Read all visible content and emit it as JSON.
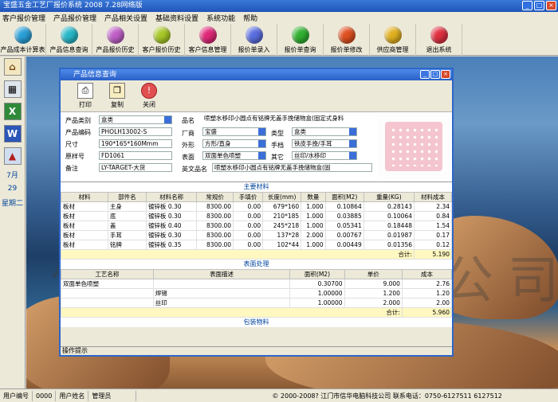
{
  "app": {
    "title": "宝盛五金工艺厂报价系统 2008 7.28网络版"
  },
  "menu": [
    "客户报价管理",
    "产品报价管理",
    "产品相关设置",
    "基础资料设置",
    "系统功能",
    "帮助"
  ],
  "toolbar": [
    {
      "label": "产品成本计算表",
      "color": "#2aa0d8"
    },
    {
      "label": "产品信息查询",
      "color": "#28b8c8"
    },
    {
      "label": "产品报价历史",
      "color": "#c060c8"
    },
    {
      "label": "客户报价历史",
      "color": "#a8c828"
    },
    {
      "label": "客户信息管理",
      "color": "#e02878"
    },
    {
      "label": "报价单录入",
      "color": "#5a6ee0"
    },
    {
      "label": "报价单查询",
      "color": "#30b030"
    },
    {
      "label": "报价单修改",
      "color": "#e05020"
    },
    {
      "label": "供应商管理",
      "color": "#e0b020"
    },
    {
      "label": "退出系统",
      "color": "#e03040"
    }
  ],
  "sidebar": {
    "month": "7月",
    "day": "29",
    "weekday": "星期二"
  },
  "watermark": "信华电脑科技公司",
  "window": {
    "title": "产品信息查询",
    "buttons": {
      "print": "打印",
      "copy": "复制",
      "close": "关闭"
    }
  },
  "form": {
    "category_label": "产品类别",
    "category": "盒类",
    "code_label": "产品编码",
    "code": "PHOLH13002-S",
    "size_label": "尺寸",
    "size": "190*165*160Mmm",
    "orig_label": "原样号",
    "orig": "FD1061",
    "note_label": "备注",
    "note": "LY-TARGET-大货",
    "name_label": "品名",
    "name": "喷塑水移印小圆点有铭牌无盖手挽储物盒(固定式身料",
    "factory_label": "厂商",
    "factory": "宝盛",
    "type_label": "类型",
    "type": "盒类",
    "shape_label": "外形",
    "shape": "方形/直身",
    "handle_label": "手档",
    "handle": "铁皮手挽/手耳",
    "surface_label": "表面",
    "surface": "双面单色喷塑",
    "other_label": "其它",
    "other": "丝印/水移印",
    "en_label": "英文品名",
    "en": "喷塑水移印小圆点有铭牌无盖手挽储物盒(固"
  },
  "materials": {
    "title": "主要材料",
    "headers": [
      "材料",
      "部件名",
      "材料名称",
      "常规价",
      "手填价",
      "长度(mm)",
      "数量",
      "面积(M2)",
      "重量(KG)",
      "材料成本"
    ],
    "rows": [
      [
        "板材",
        "主身",
        "镀锌板 0.30",
        "8300.00",
        "0.00",
        "679*160",
        "1.000",
        "0.10864",
        "0.28143",
        "2.34"
      ],
      [
        "板材",
        "底",
        "镀锌板 0.30",
        "8300.00",
        "0.00",
        "210*185",
        "1.000",
        "0.03885",
        "0.10064",
        "0.84"
      ],
      [
        "板材",
        "盖",
        "镀锌板 0.40",
        "8300.00",
        "0.00",
        "245*218",
        "1.000",
        "0.05341",
        "0.18448",
        "1.54"
      ],
      [
        "板材",
        "手耳",
        "镀锌板 0.30",
        "8300.00",
        "0.00",
        "137*28",
        "2.000",
        "0.00767",
        "0.01987",
        "0.17"
      ],
      [
        "板材",
        "铭牌",
        "镀锌板 0.35",
        "8300.00",
        "0.00",
        "102*44",
        "1.000",
        "0.00449",
        "0.01356",
        "0.12"
      ]
    ],
    "total_label": "合计:",
    "total": "5.190"
  },
  "surface_tbl": {
    "title": "表面处理",
    "headers": [
      "工艺名称",
      "表面描述",
      "面积(M2)",
      "单价",
      "成本"
    ],
    "rows": [
      [
        "双面单色喷塑",
        "",
        "0.30700",
        "9.000",
        "2.76"
      ],
      [
        "",
        "焊锡",
        "1.00000",
        "1.200",
        "1.20"
      ],
      [
        "",
        "丝印",
        "1.00000",
        "2.000",
        "2.00"
      ]
    ],
    "total_label": "合计:",
    "total": "5.960"
  },
  "packing": {
    "title": "包装物料"
  },
  "tab": "操作提示",
  "status": {
    "user_no_label": "用户编号",
    "user_no": "0000",
    "user_name_label": "用户姓名",
    "user_name": "管理员",
    "copyright": "© 2000-2008? 江门市信华电脑科技公司 联系电话：0750-6127511 6127512"
  }
}
